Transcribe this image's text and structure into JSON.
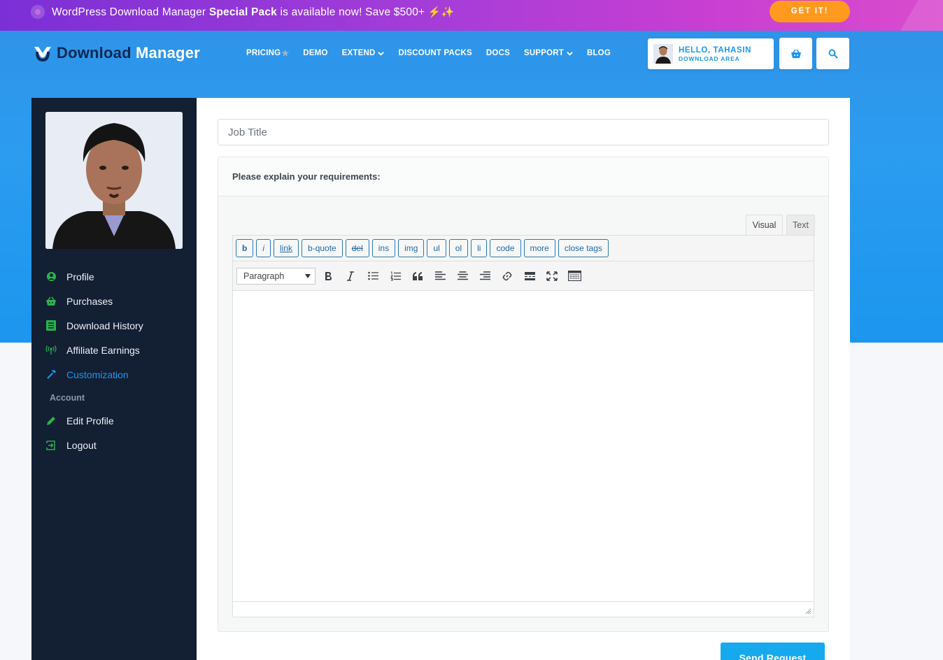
{
  "promo": {
    "text_prefix": "WordPress Download Manager ",
    "text_bold": "Special Pack",
    "text_suffix": " is available now! Save $500+ ",
    "emoji": "⚡✨",
    "cta": "GET IT!"
  },
  "header": {
    "logo_dark": "Download",
    "logo_light": " Manager",
    "nav": [
      {
        "label": "PRICING",
        "badge": "★"
      },
      {
        "label": "DEMO"
      },
      {
        "label": "EXTEND",
        "dropdown": true
      },
      {
        "label": "DISCOUNT PACKS"
      },
      {
        "label": "DOCS"
      },
      {
        "label": "SUPPORT",
        "dropdown": true
      },
      {
        "label": "BLOG"
      }
    ],
    "user": {
      "hello": "HELLO, TAHASIN",
      "sub": "DOWNLOAD AREA"
    },
    "cart_icon": "basket-icon",
    "search_icon": "search-icon"
  },
  "sidebar": {
    "items": [
      {
        "label": "Profile",
        "icon": "user-circle-icon"
      },
      {
        "label": "Purchases",
        "icon": "basket-icon"
      },
      {
        "label": "Download History",
        "icon": "list-icon"
      },
      {
        "label": "Affiliate Earnings",
        "icon": "broadcast-icon"
      },
      {
        "label": "Customization",
        "icon": "hammer-icon",
        "active": true
      }
    ],
    "account_heading": "Account",
    "account_items": [
      {
        "label": "Edit Profile",
        "icon": "pencil-icon"
      },
      {
        "label": "Logout",
        "icon": "logout-icon"
      }
    ]
  },
  "form": {
    "job_title_placeholder": "Job Title",
    "requirements_label": "Please explain your requirements:",
    "tabs": {
      "visual": "Visual",
      "text": "Text"
    },
    "quicktags": [
      "b",
      "i",
      "link",
      "b-quote",
      "del",
      "ins",
      "img",
      "ul",
      "ol",
      "li",
      "code",
      "more",
      "close tags"
    ],
    "format_select": "Paragraph",
    "send_label": "Send Request"
  },
  "colors": {
    "accent": "#1b96ee",
    "sidebar_bg": "#131f33",
    "promo_cta": "#ff9a1f",
    "icon_green": "#27b34a"
  }
}
